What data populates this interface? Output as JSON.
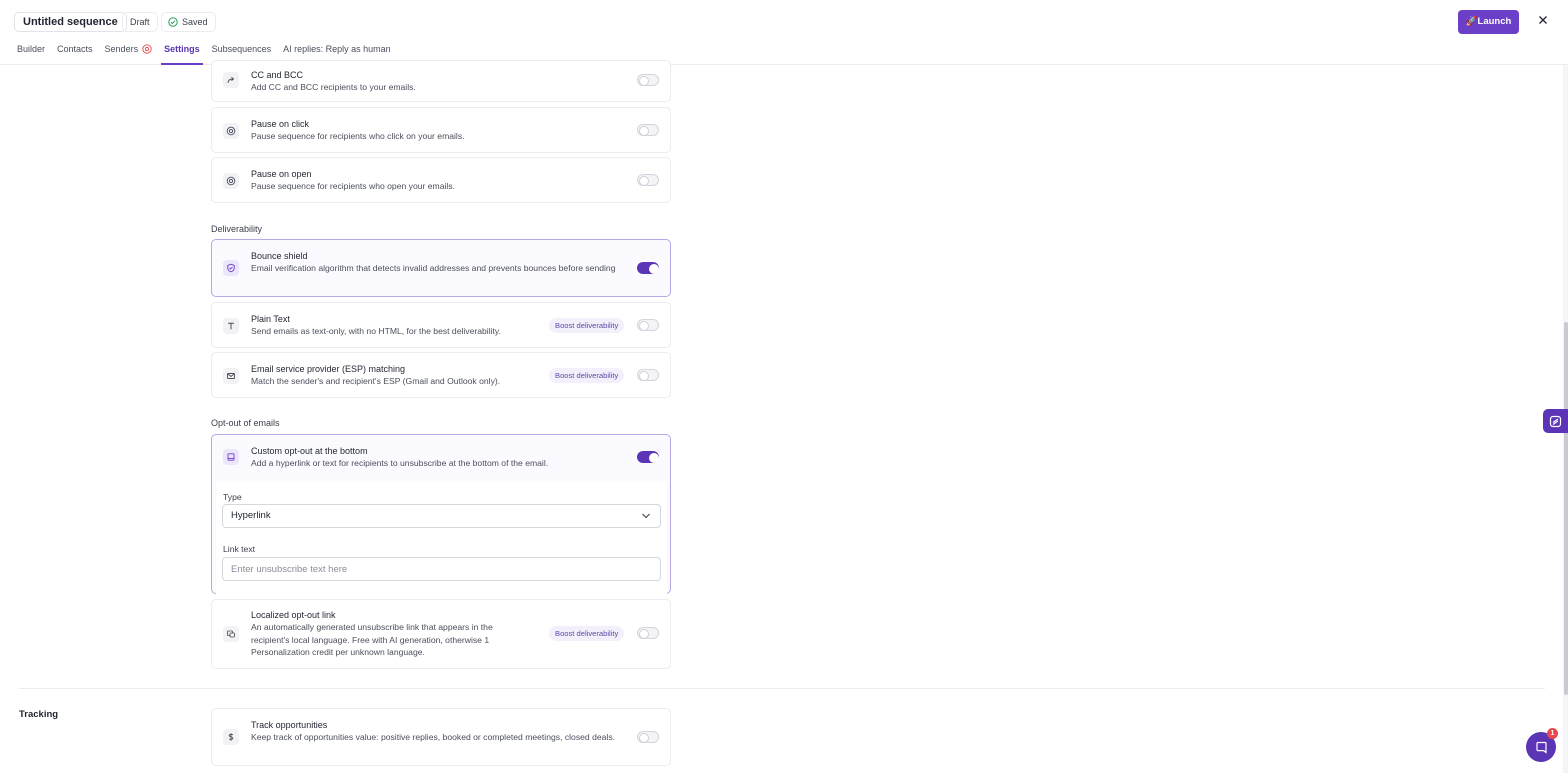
{
  "header": {
    "title": "Untitled sequence",
    "draft": "Draft",
    "saved": "Saved",
    "launch": "🚀Launch"
  },
  "tabs": [
    {
      "label": "Builder"
    },
    {
      "label": "Contacts"
    },
    {
      "label": "Senders"
    },
    {
      "label": "Settings",
      "active": true
    },
    {
      "label": "Subsequences"
    },
    {
      "label": "AI replies: Reply as human"
    }
  ],
  "cards": {
    "cc": {
      "title": "CC and BCC",
      "desc": "Add CC and BCC recipients to your emails.",
      "enabled": false,
      "icon": "forward-arrow-icon"
    },
    "pause_click": {
      "title": "Pause on click",
      "desc": "Pause sequence for recipients who click on your emails.",
      "enabled": false,
      "icon": "target-icon"
    },
    "pause_open": {
      "title": "Pause on open",
      "desc": "Pause sequence for recipients who open your emails.",
      "enabled": false,
      "icon": "target-icon"
    }
  },
  "deliverability": {
    "label": "Deliverability",
    "bounce": {
      "title": "Bounce shield",
      "desc": "Email verification algorithm that detects invalid addresses and prevents bounces before sending",
      "enabled": true,
      "icon": "shield-check-icon"
    },
    "plain": {
      "title": "Plain Text",
      "desc": "Send emails as text-only, with no HTML, for the best deliverability.",
      "badge": "Boost deliverability",
      "enabled": false,
      "icon": "text-t-icon"
    },
    "esp": {
      "title": "Email service provider (ESP) matching",
      "desc": "Match the sender's and recipient's ESP (Gmail and Outlook only).",
      "badge": "Boost deliverability",
      "enabled": false,
      "icon": "envelope-icon"
    }
  },
  "optout": {
    "label": "Opt-out of emails",
    "custom": {
      "title": "Custom opt-out at the bottom",
      "desc": "Add a hyperlink or text for recipients to unsubscribe at the bottom of the email.",
      "enabled": true,
      "icon": "window-bottom-icon"
    },
    "type_label": "Type",
    "type_value": "Hyperlink",
    "link_label": "Link text",
    "link_placeholder": "Enter unsubscribe text here",
    "localized": {
      "title": "Localized opt-out link",
      "desc": "An automatically generated unsubscribe link that appears in the recipient's local language. Free with AI generation, otherwise 1 Personalization credit per unknown language.",
      "badge": "Boost deliverability",
      "enabled": false,
      "icon": "language-icon"
    }
  },
  "tracking": {
    "label": "Tracking",
    "opportunities": {
      "title": "Track opportunities",
      "desc": "Keep track of opportunities value: positive replies, booked or completed meetings, closed deals.",
      "enabled": false,
      "icon": "dollar-icon"
    }
  },
  "chat": {
    "count": "1"
  },
  "colors": {
    "accent": "#6b3fc8",
    "accent_dark": "#5b35b5",
    "badge_red": "#e5484d"
  }
}
